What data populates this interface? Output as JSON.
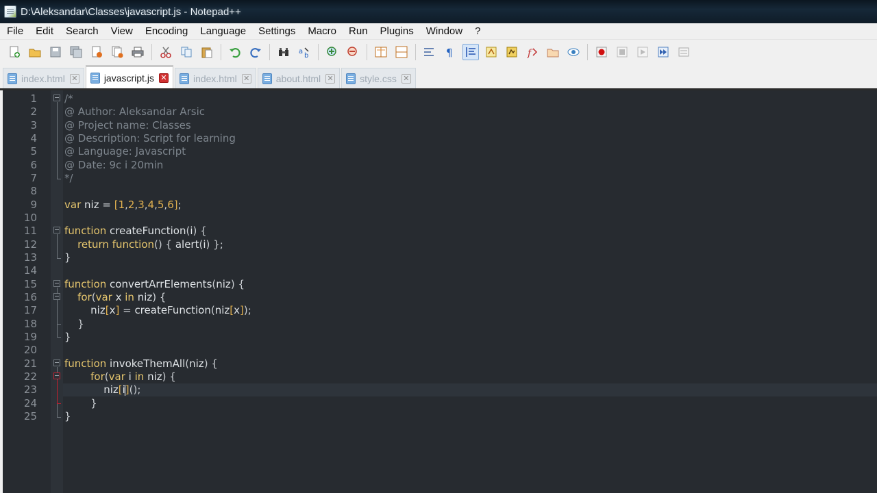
{
  "window": {
    "title": "D:\\Aleksandar\\Classes\\javascript.js - Notepad++"
  },
  "menu": [
    "File",
    "Edit",
    "Search",
    "View",
    "Encoding",
    "Language",
    "Settings",
    "Macro",
    "Run",
    "Plugins",
    "Window",
    "?"
  ],
  "toolbar": {
    "icons": [
      "new-file-icon",
      "open-file-icon",
      "save-icon",
      "save-all-icon",
      "close-icon",
      "close-all-icon",
      "print-icon",
      "cut-icon",
      "copy-icon",
      "paste-icon",
      "undo-icon",
      "redo-icon",
      "find-icon",
      "replace-icon",
      "zoom-in-icon",
      "zoom-out-icon",
      "sync-vertical-icon",
      "sync-horizontal-icon",
      "word-wrap-icon",
      "show-all-chars-icon",
      "indent-guide-icon",
      "user-lang-icon",
      "doc-map-icon",
      "function-list-icon",
      "folder-workspace-icon",
      "monitoring-icon",
      "record-macro-icon",
      "stop-record-icon",
      "play-macro-icon",
      "run-macro-multiple-icon",
      "save-macro-icon"
    ]
  },
  "tabs": [
    {
      "label": "index.html",
      "active": false
    },
    {
      "label": "javascript.js",
      "active": true
    },
    {
      "label": "index.html",
      "active": false
    },
    {
      "label": "about.html",
      "active": false
    },
    {
      "label": "style.css",
      "active": false
    }
  ],
  "editor": {
    "current_line": 23,
    "lines": [
      "/*",
      "@ Author: Aleksandar Arsic",
      "@ Project name: Classes",
      "@ Description: Script for learning",
      "@ Language: Javascript",
      "@ Date: 9c i 20min",
      "*/",
      "",
      "var niz = [1,2,3,4,5,6];",
      "",
      "function createFunction(i) {",
      "    return function() { alert(i) };",
      "}",
      "",
      "function convertArrElements(niz) {",
      "    for(var x in niz) {",
      "        niz[x] = createFunction(niz[x]);",
      "    }",
      "}",
      "",
      "function invokeThemAll(niz) {",
      "        for(var i in niz) {",
      "            niz[i]();",
      "        }",
      "}"
    ]
  },
  "colors": {
    "editor_bg": "#272b30",
    "comment": "#7d858d",
    "keyword": "#e7c76e",
    "tab_accent": "#f0a020"
  }
}
